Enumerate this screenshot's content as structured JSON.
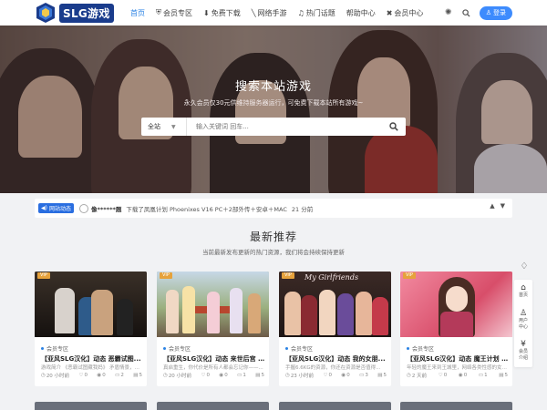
{
  "brand": {
    "logo_text": "SLG游戏",
    "accent": "#2a82e4"
  },
  "nav": {
    "items": [
      {
        "label": "首页",
        "icon": "",
        "active": true
      },
      {
        "label": "会员专区",
        "icon": "shield-icon"
      },
      {
        "label": "免费下载",
        "icon": "download-icon"
      },
      {
        "label": "网络手游",
        "icon": "gamepad-icon"
      },
      {
        "label": "热门话题",
        "icon": "bell-icon"
      },
      {
        "label": "帮助中心",
        "icon": ""
      },
      {
        "label": "会员中心",
        "icon": "gift-icon"
      }
    ]
  },
  "header_right": {
    "theme_icon": "sun-icon",
    "search_icon": "search-icon",
    "login_label": "登录"
  },
  "hero": {
    "title": "搜索本站游戏",
    "subtitle": "永久会员仅30元供维持服务器运行，可免费下载本站所有游戏~",
    "select_label": "全站",
    "search_placeholder": "输入关键词 回车..."
  },
  "ticker": {
    "badge": "网站动态",
    "user": "像******题",
    "message": "下载了凤凰计划 Phoenixes V16 PC＋2部外传＋安卓＋MAC",
    "time": "21 分前"
  },
  "section": {
    "title": "最新推荐",
    "subtitle": "当前最新发布更新的热门资源，我们将会持续保持更新"
  },
  "cards": [
    {
      "vip": "VIP",
      "category": "会员专区",
      "title": "【亚风SLG汉化】动态 恶霸试图...",
      "desc": "游戏简介 《恶霸试图藏我妈》 矛盾情景，他...",
      "time": "20 小时前",
      "likes": "0",
      "views": "0",
      "comments": "2",
      "downloads": "5"
    },
    {
      "vip": "VIP",
      "category": "会员专区",
      "title": "【亚风SLG汉化】动态 来世后宫 ...",
      "desc": "真启重生，你代价是所有人都会忘记你——...",
      "time": "20 小时前",
      "likes": "0",
      "views": "0",
      "comments": "1",
      "downloads": "5"
    },
    {
      "vip": "VIP",
      "category": "会员专区",
      "title": "【亚风SLG汉化】动态 我的女朋...",
      "desc": "手握6.6KG的资源，你还在资源是否值得...",
      "time": "23 小时前",
      "likes": "0",
      "views": "0",
      "comments": "3",
      "downloads": "5"
    },
    {
      "vip": "VIP",
      "category": "会员专区",
      "title": "【亚风SLG汉化】动态 魔王计划 ...",
      "desc": "年轻的魔王来到王城里，网络各类性感的女巫们...",
      "time": "2 天前",
      "likes": "0",
      "views": "0",
      "comments": "1",
      "downloads": "5"
    }
  ],
  "card_badge_color": "#e6a23c",
  "float_bar": [
    {
      "icon": "home-icon",
      "label": "首页"
    },
    {
      "icon": "user-icon",
      "label": "用户中心"
    },
    {
      "icon": "money-icon",
      "label": "会员介绍"
    }
  ]
}
